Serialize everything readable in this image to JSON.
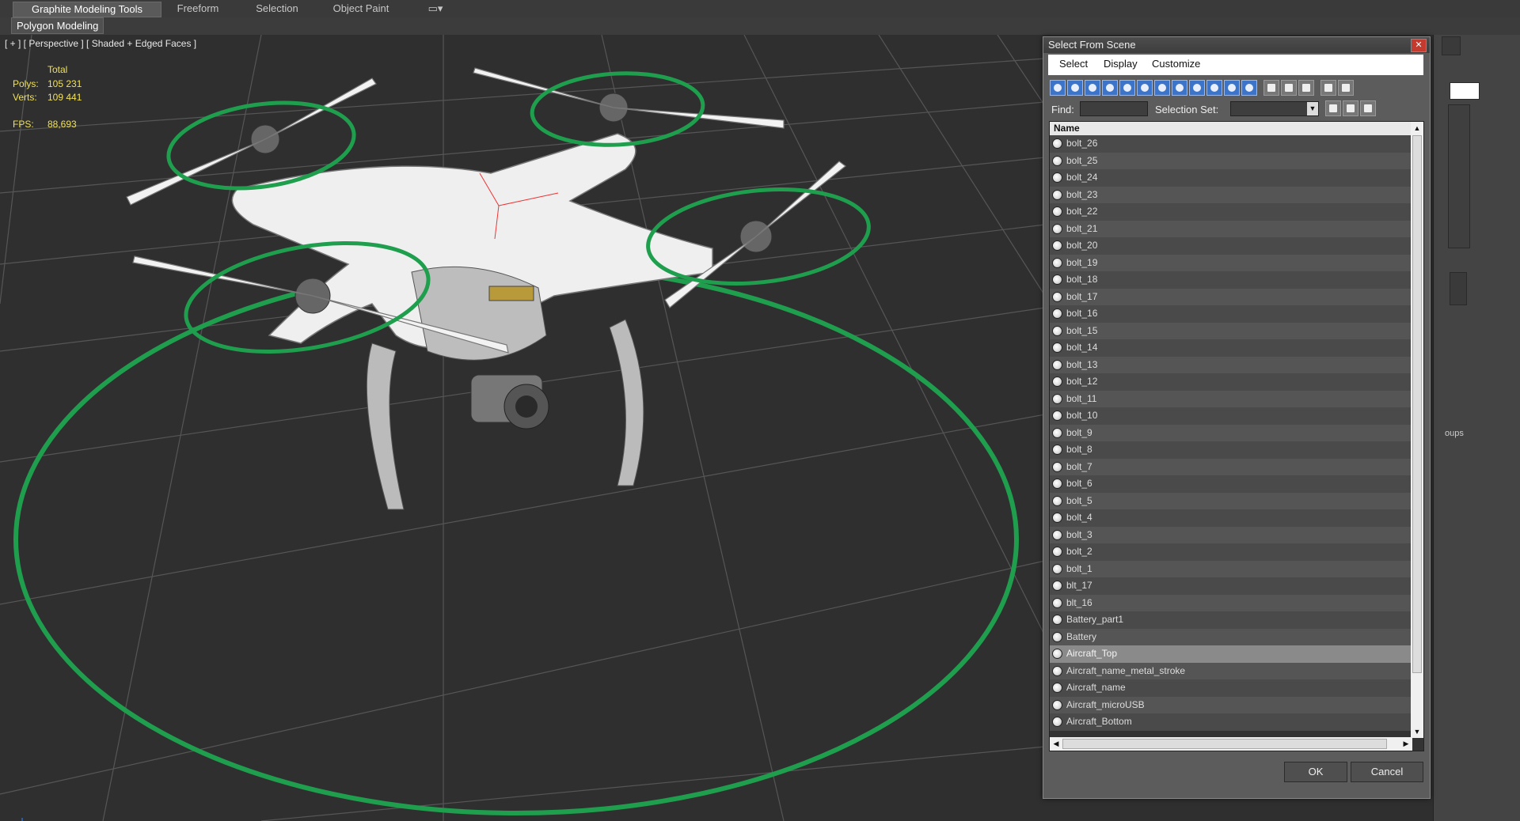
{
  "ribbon": {
    "tabs": [
      "Graphite Modeling Tools",
      "Freeform",
      "Selection",
      "Object Paint"
    ],
    "subtab": "Polygon Modeling"
  },
  "viewport": {
    "label": "[ + ] [ Perspective ] [ Shaded + Edged Faces ]",
    "stats": {
      "total_label": "Total",
      "polys_label": "Polys:",
      "polys_value": "105 231",
      "verts_label": "Verts:",
      "verts_value": "109 441",
      "fps_label": "FPS:",
      "fps_value": "88,693"
    }
  },
  "command_panel": {
    "partial_text": "oups"
  },
  "dialog": {
    "title": "Select From Scene",
    "close_icon": "close-icon",
    "menu": [
      "Select",
      "Display",
      "Customize"
    ],
    "find_label": "Find:",
    "find_value": "",
    "selection_set_label": "Selection Set:",
    "selection_set_value": "",
    "column_header": "Name",
    "items": [
      {
        "name": "bolt_26",
        "selected": false
      },
      {
        "name": "bolt_25",
        "selected": false
      },
      {
        "name": "bolt_24",
        "selected": false
      },
      {
        "name": "bolt_23",
        "selected": false
      },
      {
        "name": "bolt_22",
        "selected": false
      },
      {
        "name": "bolt_21",
        "selected": false
      },
      {
        "name": "bolt_20",
        "selected": false
      },
      {
        "name": "bolt_19",
        "selected": false
      },
      {
        "name": "bolt_18",
        "selected": false
      },
      {
        "name": "bolt_17",
        "selected": false
      },
      {
        "name": "bolt_16",
        "selected": false
      },
      {
        "name": "bolt_15",
        "selected": false
      },
      {
        "name": "bolt_14",
        "selected": false
      },
      {
        "name": "bolt_13",
        "selected": false
      },
      {
        "name": "bolt_12",
        "selected": false
      },
      {
        "name": "bolt_11",
        "selected": false
      },
      {
        "name": "bolt_10",
        "selected": false
      },
      {
        "name": "bolt_9",
        "selected": false
      },
      {
        "name": "bolt_8",
        "selected": false
      },
      {
        "name": "bolt_7",
        "selected": false
      },
      {
        "name": "bolt_6",
        "selected": false
      },
      {
        "name": "bolt_5",
        "selected": false
      },
      {
        "name": "bolt_4",
        "selected": false
      },
      {
        "name": "bolt_3",
        "selected": false
      },
      {
        "name": "bolt_2",
        "selected": false
      },
      {
        "name": "bolt_1",
        "selected": false
      },
      {
        "name": "blt_17",
        "selected": false
      },
      {
        "name": "blt_16",
        "selected": false
      },
      {
        "name": "Battery_part1",
        "selected": false
      },
      {
        "name": "Battery",
        "selected": false
      },
      {
        "name": "Aircraft_Top",
        "selected": true
      },
      {
        "name": "Aircraft_name_metal_stroke",
        "selected": false
      },
      {
        "name": "Aircraft_name",
        "selected": false
      },
      {
        "name": "Aircraft_microUSB",
        "selected": false
      },
      {
        "name": "Aircraft_Bottom",
        "selected": false
      }
    ],
    "ok_label": "OK",
    "cancel_label": "Cancel"
  },
  "colors": {
    "viewport_bg": "#2f2f2f",
    "grid": "#555555",
    "helper_circle": "#1f9e4e",
    "stats_text": "#f0e05a",
    "selection": "#8a8a8a"
  }
}
